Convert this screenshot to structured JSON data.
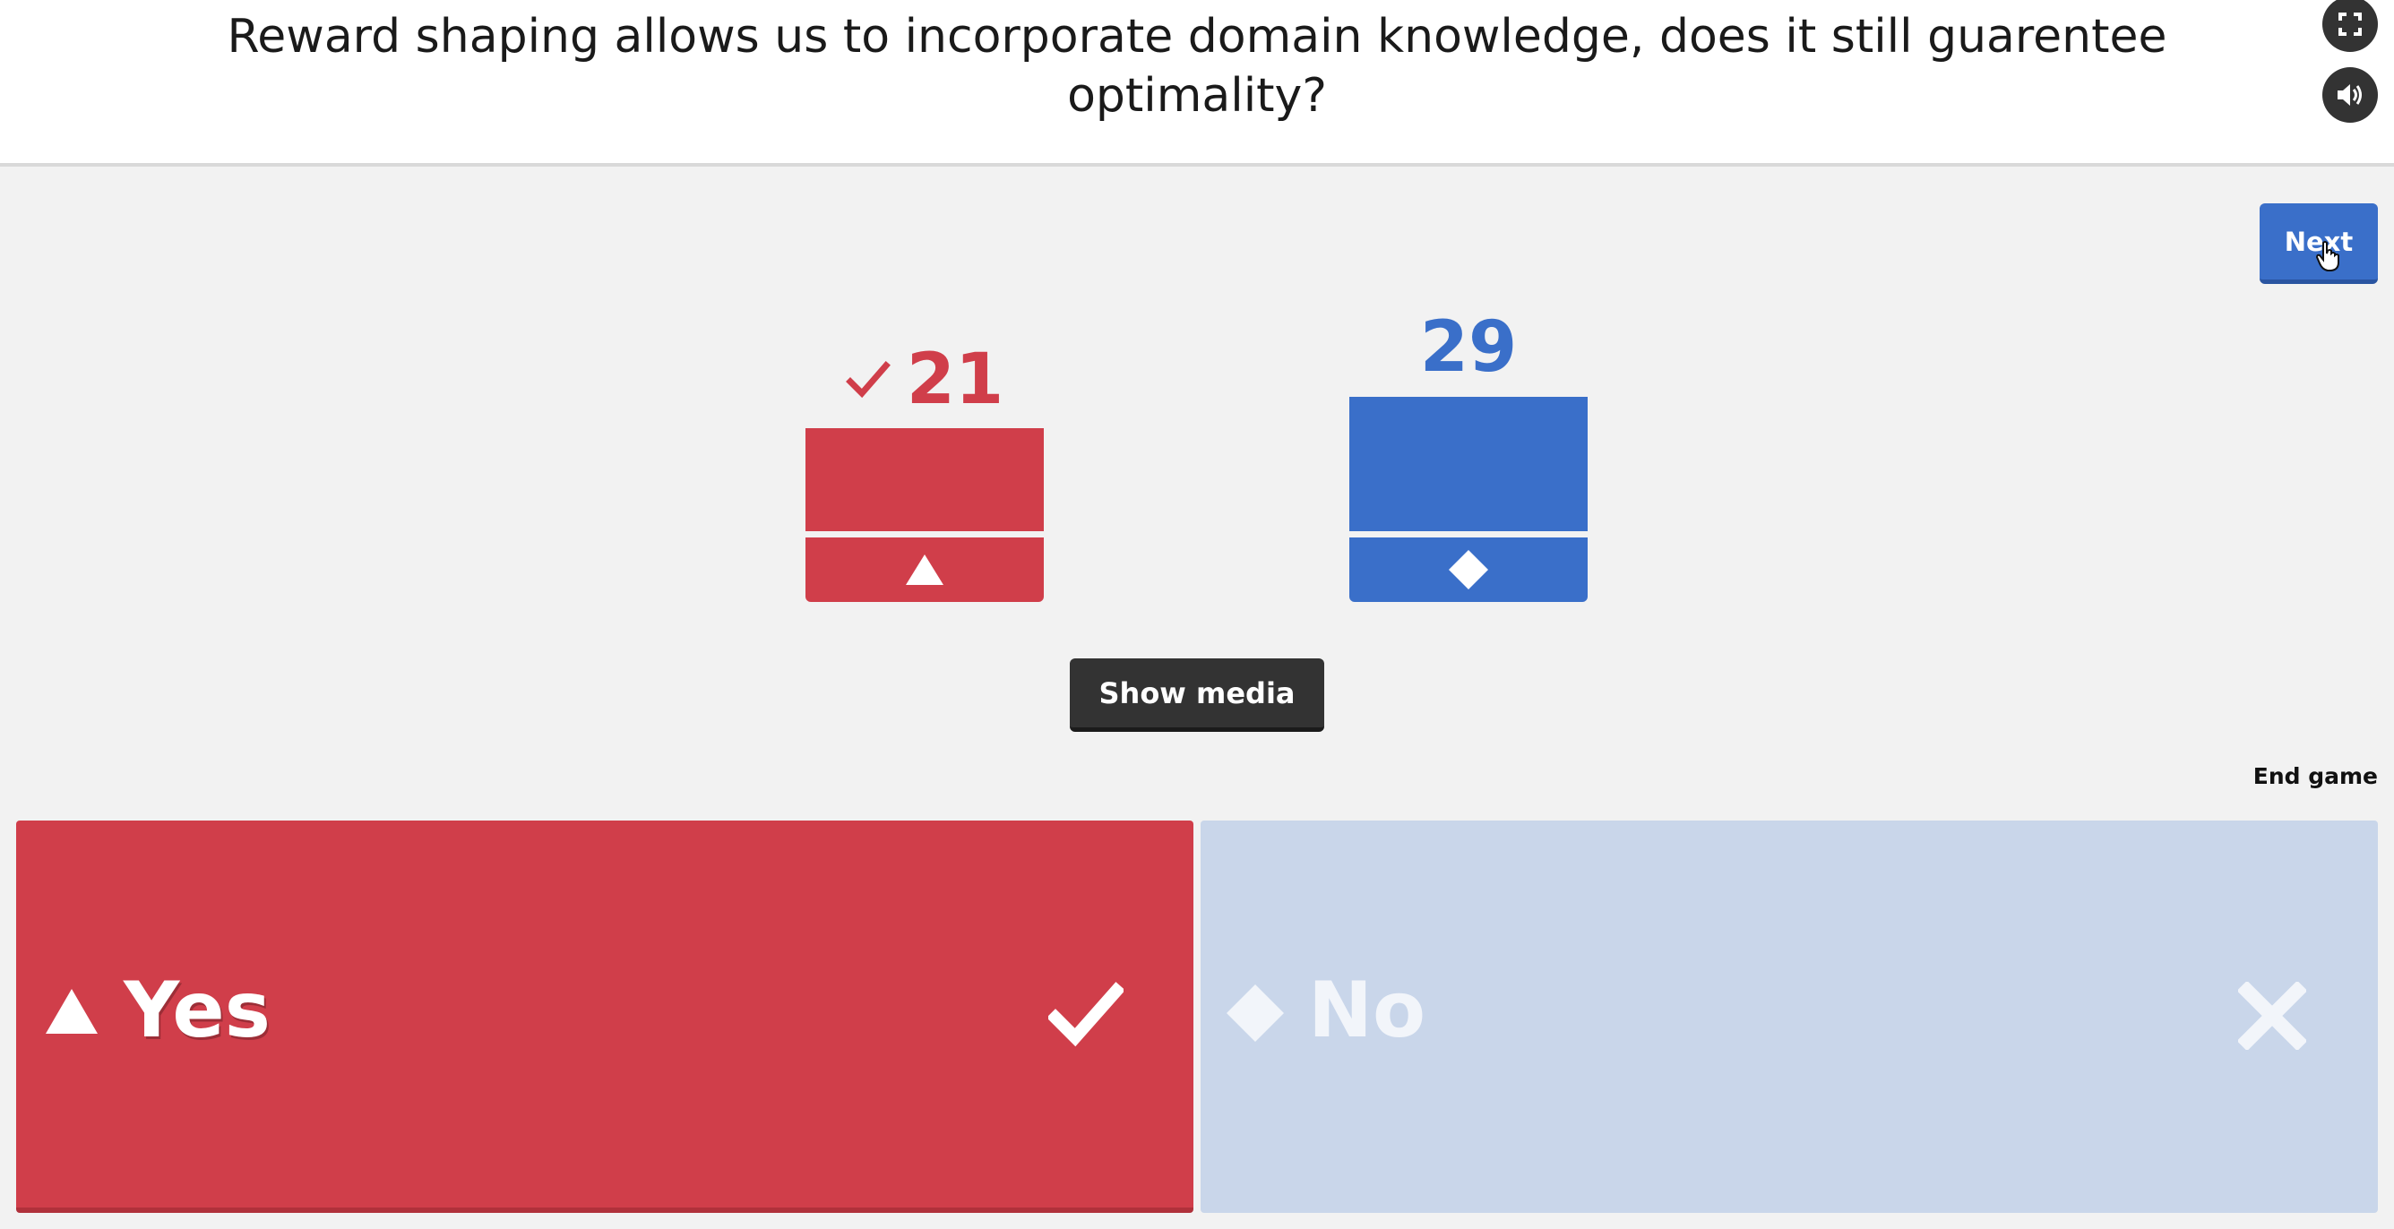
{
  "header": {
    "question": "Reward shaping allows us to incorporate domain knowledge, does it still guarentee optimality?",
    "fullscreen_icon": "fullscreen-icon",
    "sound_icon": "speaker-icon"
  },
  "controls": {
    "next_label": "Next",
    "show_media_label": "Show media",
    "end_game_label": "End game"
  },
  "results": {
    "counts": [
      {
        "shape": "triangle",
        "count": "21",
        "correct": true,
        "color": "#d03e4a"
      },
      {
        "shape": "diamond",
        "count": "29",
        "correct": false,
        "color": "#3a6fc9"
      }
    ]
  },
  "answers": [
    {
      "shape": "triangle",
      "label": "Yes",
      "correct": true,
      "color": "#d03e4a"
    },
    {
      "shape": "diamond",
      "label": "No",
      "correct": false,
      "color": "#c9d6ea"
    }
  ]
}
